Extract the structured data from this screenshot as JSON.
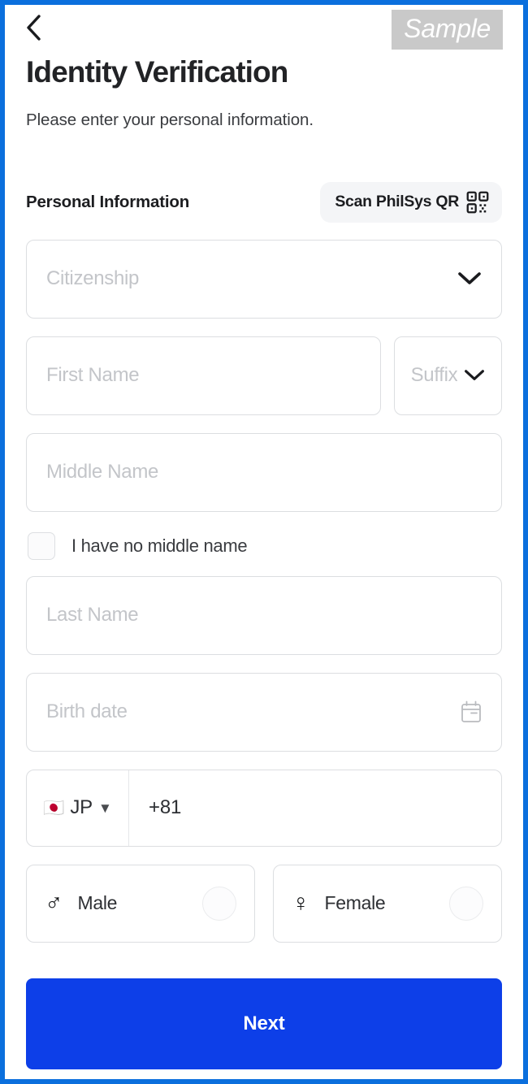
{
  "window": {
    "border_color": "#0b6fdd"
  },
  "header": {
    "back_icon": "chevron-left-icon",
    "watermark": "Sample",
    "title": "Identity Verification",
    "subtitle": "Please enter your personal information."
  },
  "section": {
    "title": "Personal Information",
    "scan_button": {
      "label": "Scan PhilSys QR",
      "icon": "qr-code-icon"
    }
  },
  "form": {
    "citizenship": {
      "placeholder": "Citizenship",
      "value": "",
      "icon": "chevron-down-icon"
    },
    "first_name": {
      "placeholder": "First Name",
      "value": ""
    },
    "suffix": {
      "placeholder": "Suffix",
      "value": "",
      "icon": "chevron-down-icon"
    },
    "middle_name": {
      "placeholder": "Middle Name",
      "value": ""
    },
    "no_middle_name": {
      "label": "I have no middle name",
      "checked": false
    },
    "last_name": {
      "placeholder": "Last Name",
      "value": ""
    },
    "birth_date": {
      "placeholder": "Birth date",
      "value": "",
      "icon": "calendar-icon"
    },
    "phone": {
      "country_flag": "🇯🇵",
      "country_code": "JP",
      "caret": "▼",
      "dial_code": "+81",
      "value": ""
    },
    "gender": {
      "male": {
        "symbol": "♂",
        "label": "Male",
        "selected": false
      },
      "female": {
        "symbol": "♀",
        "label": "Female",
        "selected": false
      }
    }
  },
  "footer": {
    "next_label": "Next",
    "accent_color": "#0d3fe8"
  }
}
